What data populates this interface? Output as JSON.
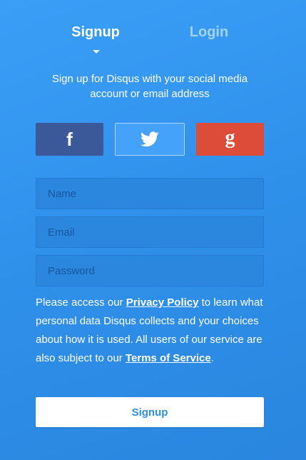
{
  "tabs": {
    "signup": "Signup",
    "login": "Login"
  },
  "intro": "Sign up for Disqus with your social media account or email address",
  "social": {
    "facebook": {
      "icon": "facebook-icon",
      "glyph": "f",
      "color": "#3b5998"
    },
    "twitter": {
      "icon": "twitter-icon",
      "color": "#45a2fb"
    },
    "google": {
      "icon": "google-icon",
      "glyph": "g",
      "color": "#dd4b39"
    }
  },
  "form": {
    "name_placeholder": "Name",
    "email_placeholder": "Email",
    "password_placeholder": "Password"
  },
  "legal": {
    "part1": "Please access our ",
    "privacy_link": "Privacy Policy",
    "part2": " to learn what personal data Disqus collects and your choices about how it is used. All users of our service are also subject to our ",
    "terms_link": "Terms of Service",
    "part3": "."
  },
  "submit_label": "Signup",
  "colors": {
    "background": "#3a9ef7",
    "accent": "#2e8fe9"
  }
}
